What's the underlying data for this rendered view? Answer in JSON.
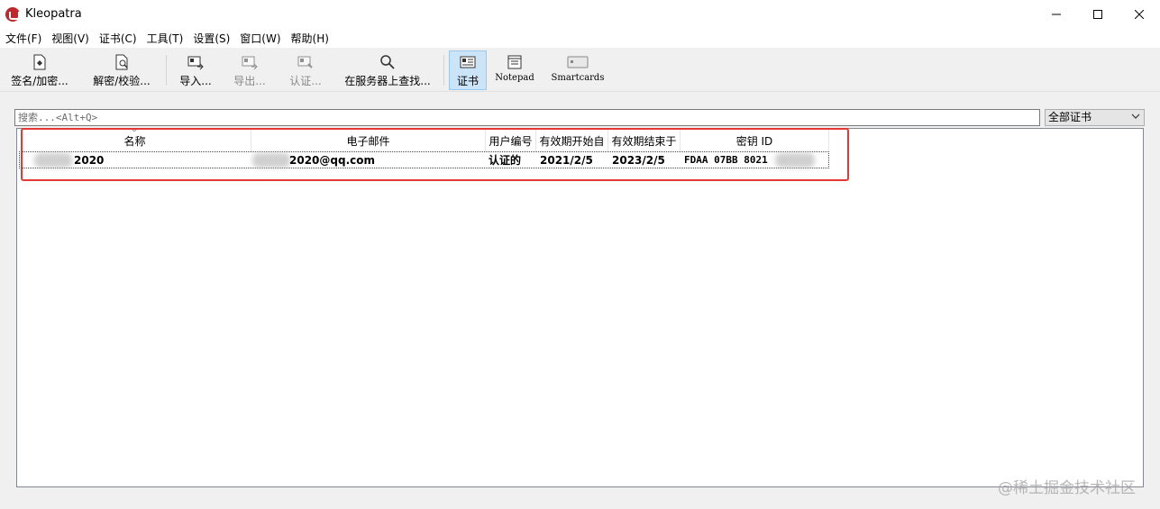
{
  "window": {
    "title": "Kleopatra",
    "minimize": "—",
    "maximize": "☐",
    "close": "✕"
  },
  "menu": [
    "文件(F)",
    "视图(V)",
    "证书(C)",
    "工具(T)",
    "设置(S)",
    "窗口(W)",
    "帮助(H)"
  ],
  "toolbar": {
    "sign_encrypt": "签名/加密...",
    "decrypt_verify": "解密/校验...",
    "import": "导入...",
    "export": "导出...",
    "certify": "认证...",
    "lookup_server": "在服务器上查找...",
    "certificates": "证书",
    "notepad": "Notepad",
    "smartcards": "Smartcards"
  },
  "search": {
    "placeholder": "搜索...<Alt+Q>"
  },
  "filter": {
    "selected": "全部证书"
  },
  "columns": [
    "名称",
    "电子邮件",
    "用户编号",
    "有效期开始自",
    "有效期结束于",
    "密钥 ID"
  ],
  "rows": [
    {
      "name": "2020",
      "email": "2020@qq.com",
      "user_id": "认证的",
      "valid_from": "2021/2/5",
      "valid_until": "2023/2/5",
      "key_id": "FDAA 07BB 8021"
    }
  ],
  "watermark": "@稀土掘金技术社区",
  "colors": {
    "highlight": "#e53935",
    "active_toolbar": "#cce4f7"
  }
}
